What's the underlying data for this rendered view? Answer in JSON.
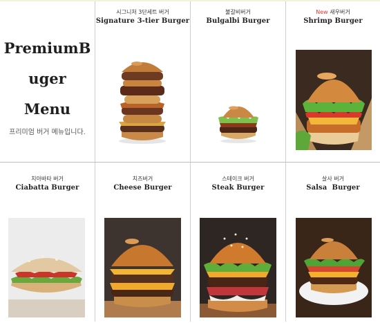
{
  "hero": {
    "title_line1": "PremiumB",
    "title_line2": "uger",
    "title_line3": "Menu",
    "subtitle": "프리미엄 버거 메뉴입니다."
  },
  "items": [
    {
      "korean": "시그니처 3단세트 버거",
      "name": "Signature 3-tier Burger"
    },
    {
      "korean": "불갈비버거",
      "name": "Bulgalbi Burger"
    },
    {
      "new_badge": "New",
      "korean": "새우버거",
      "name": "Shrimp Burger"
    },
    {
      "korean": "치아바타 버거",
      "name": "Ciabatta Burger"
    },
    {
      "korean": "치즈버거",
      "name": "Cheese Burger"
    },
    {
      "korean": "스테이크 버거",
      "name": "Steak Burger"
    },
    {
      "korean": "살사 버거",
      "name": "Salsa  Burger"
    }
  ],
  "colors": {
    "new_badge": "#e23a2e",
    "divider": "#cfcfcf"
  }
}
